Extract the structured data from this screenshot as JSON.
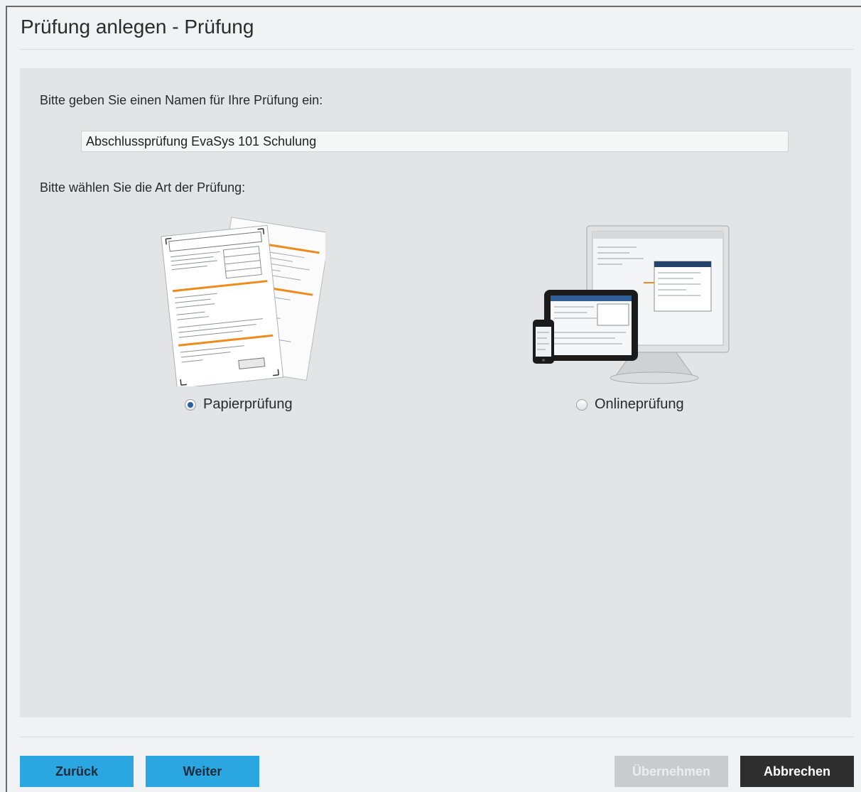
{
  "dialog": {
    "title": "Prüfung anlegen - Prüfung"
  },
  "form": {
    "name_prompt": "Bitte geben Sie einen Namen für Ihre Prüfung ein:",
    "name_value": "Abschlussprüfung EvaSys 101 Schulung",
    "type_prompt": "Bitte wählen Sie die Art der Prüfung:",
    "options": [
      {
        "label": "Papierprüfung",
        "icon": "paper-forms-icon",
        "selected": true
      },
      {
        "label": "Onlineprüfung",
        "icon": "devices-icon",
        "selected": false
      }
    ]
  },
  "footer": {
    "back_label": "Zurück",
    "next_label": "Weiter",
    "apply_label": "Übernehmen",
    "cancel_label": "Abbrechen"
  },
  "colors": {
    "primary_button": "#2aa6e0",
    "cancel_button": "#2e2e2e",
    "disabled_button": "#c9cbcc",
    "accent_orange": "#f08a1c"
  }
}
